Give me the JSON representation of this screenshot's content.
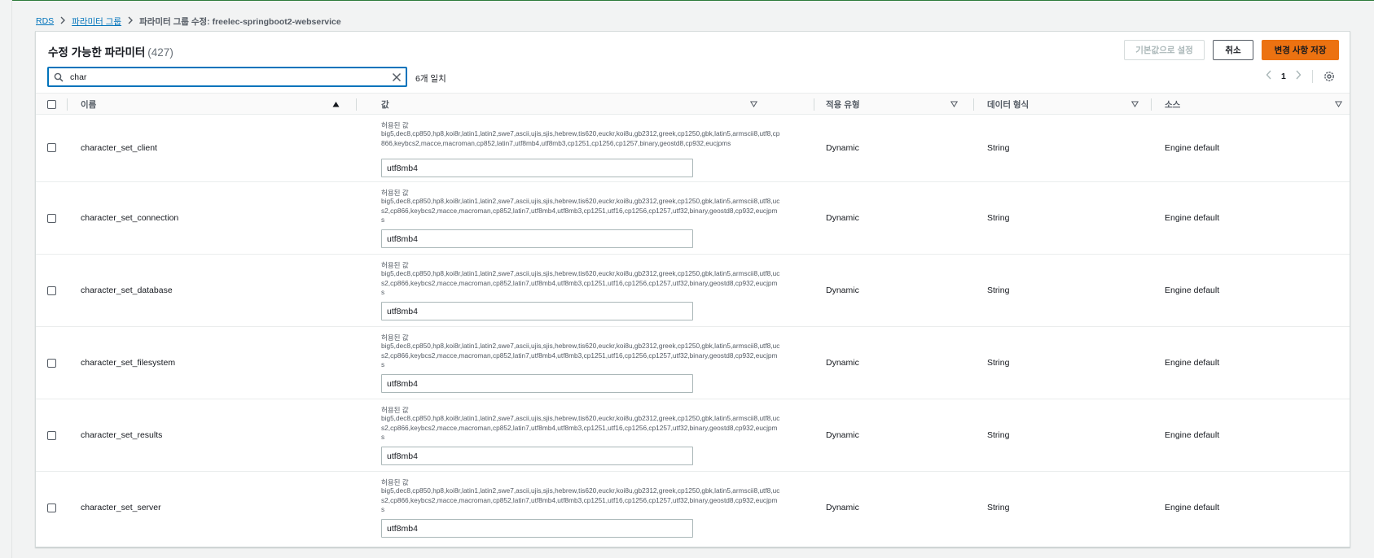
{
  "breadcrumb": {
    "items": [
      {
        "label": "RDS"
      },
      {
        "label": "파라미터 그룹"
      },
      {
        "label": "파라미터 그룹 수정: freelec-springboot2-webservice"
      }
    ]
  },
  "panel": {
    "title": "수정 가능한 파라미터",
    "count": "(427)",
    "buttons": {
      "reset": "기본값으로 설정",
      "cancel": "취소",
      "save": "변경 사항 저장"
    }
  },
  "search": {
    "value": "char",
    "match_count": "6개 일치"
  },
  "pagination": {
    "current_page": "1"
  },
  "columns": {
    "name": "이름",
    "value": "값",
    "apply_type": "적용 유형",
    "data_type": "데이터 형식",
    "source": "소스"
  },
  "rows": [
    {
      "name": "character_set_client",
      "allowed_label": "허용된 값",
      "allowed_values": "big5,dec8,cp850,hp8,koi8r,latin1,latin2,swe7,ascii,ujis,sjis,hebrew,tis620,euckr,koi8u,gb2312,greek,cp1250,gbk,latin5,armscii8,utf8,cp866,keybcs2,macce,macroman,cp852,latin7,utf8mb4,utf8mb3,cp1251,cp1256,cp1257,binary,geostd8,cp932,eucjpms",
      "value": "utf8mb4",
      "apply_type": "Dynamic",
      "data_type": "String",
      "source": "Engine default"
    },
    {
      "name": "character_set_connection",
      "allowed_label": "허용된 값",
      "allowed_values": "big5,dec8,cp850,hp8,koi8r,latin1,latin2,swe7,ascii,ujis,sjis,hebrew,tis620,euckr,koi8u,gb2312,greek,cp1250,gbk,latin5,armscii8,utf8,ucs2,cp866,keybcs2,macce,macroman,cp852,latin7,utf8mb4,utf8mb3,cp1251,utf16,cp1256,cp1257,utf32,binary,geostd8,cp932,eucjpms",
      "value": "utf8mb4",
      "apply_type": "Dynamic",
      "data_type": "String",
      "source": "Engine default"
    },
    {
      "name": "character_set_database",
      "allowed_label": "허용된 값",
      "allowed_values": "big5,dec8,cp850,hp8,koi8r,latin1,latin2,swe7,ascii,ujis,sjis,hebrew,tis620,euckr,koi8u,gb2312,greek,cp1250,gbk,latin5,armscii8,utf8,ucs2,cp866,keybcs2,macce,macroman,cp852,latin7,utf8mb4,utf8mb3,cp1251,utf16,cp1256,cp1257,utf32,binary,geostd8,cp932,eucjpms",
      "value": "utf8mb4",
      "apply_type": "Dynamic",
      "data_type": "String",
      "source": "Engine default"
    },
    {
      "name": "character_set_filesystem",
      "allowed_label": "허용된 값",
      "allowed_values": "big5,dec8,cp850,hp8,koi8r,latin1,latin2,swe7,ascii,ujis,sjis,hebrew,tis620,euckr,koi8u,gb2312,greek,cp1250,gbk,latin5,armscii8,utf8,ucs2,cp866,keybcs2,macce,macroman,cp852,latin7,utf8mb4,utf8mb3,cp1251,utf16,cp1256,cp1257,utf32,binary,geostd8,cp932,eucjpms",
      "value": "utf8mb4",
      "apply_type": "Dynamic",
      "data_type": "String",
      "source": "Engine default"
    },
    {
      "name": "character_set_results",
      "allowed_label": "허용된 값",
      "allowed_values": "big5,dec8,cp850,hp8,koi8r,latin1,latin2,swe7,ascii,ujis,sjis,hebrew,tis620,euckr,koi8u,gb2312,greek,cp1250,gbk,latin5,armscii8,utf8,ucs2,cp866,keybcs2,macce,macroman,cp852,latin7,utf8mb4,utf8mb3,cp1251,utf16,cp1256,cp1257,utf32,binary,geostd8,cp932,eucjpms",
      "value": "utf8mb4",
      "apply_type": "Dynamic",
      "data_type": "String",
      "source": "Engine default"
    },
    {
      "name": "character_set_server",
      "allowed_label": "허용된 값",
      "allowed_values": "big5,dec8,cp850,hp8,koi8r,latin1,latin2,swe7,ascii,ujis,sjis,hebrew,tis620,euckr,koi8u,gb2312,greek,cp1250,gbk,latin5,armscii8,utf8,ucs2,cp866,keybcs2,macce,macroman,cp852,latin7,utf8mb4,utf8mb3,cp1251,utf16,cp1256,cp1257,utf32,binary,geostd8,cp932,eucjpms",
      "value": "utf8mb4",
      "apply_type": "Dynamic",
      "data_type": "String",
      "source": "Engine default"
    }
  ],
  "colors": {
    "link": "#0073bb",
    "primary_button": "#ec7211",
    "focus_border": "#0073bb"
  }
}
